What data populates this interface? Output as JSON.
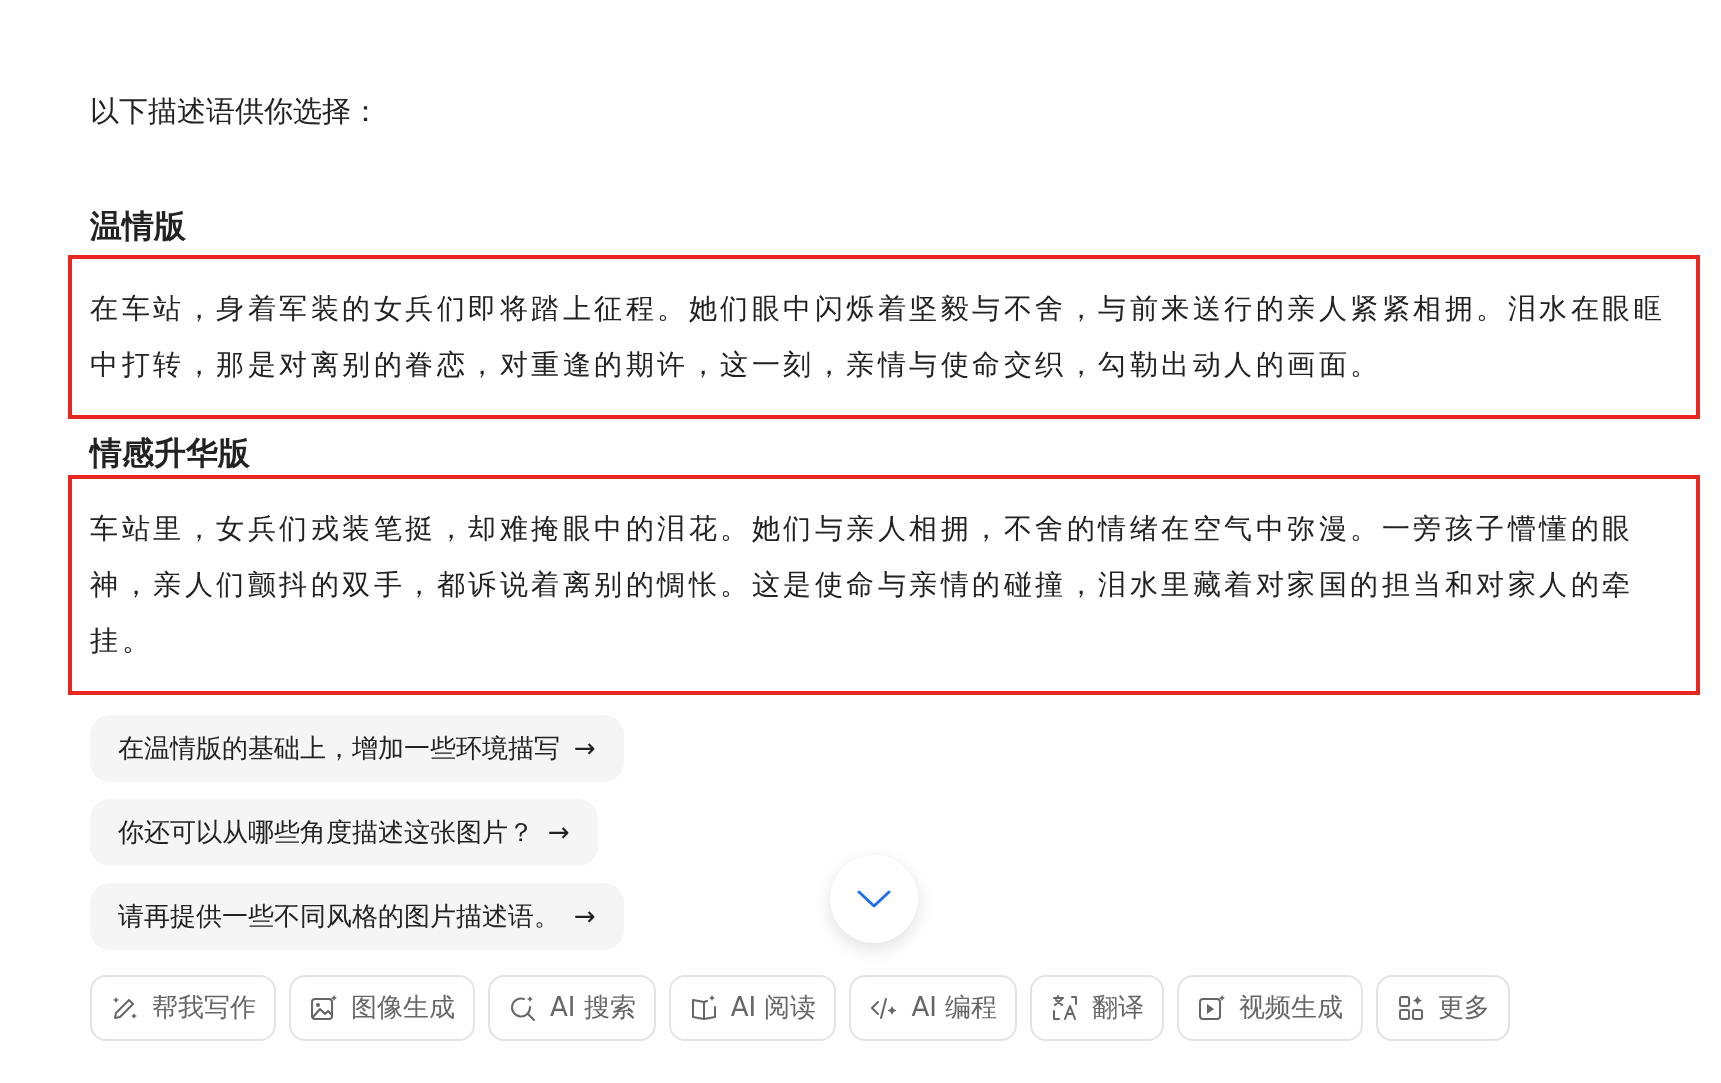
{
  "intro": "以下描述语供你选择：",
  "sections": [
    {
      "title": "温情版",
      "body": "在车站，身着军装的女兵们即将踏上征程。她们眼中闪烁着坚毅与不舍，与前来送行的亲人紧紧相拥。泪水在眼眶中打转，那是对离别的眷恋，对重逢的期许，这一刻，亲情与使命交织，勾勒出动人的画面。",
      "highlighted": true
    },
    {
      "title": "情感升华版",
      "body": "车站里，女兵们戎装笔挺，却难掩眼中的泪花。她们与亲人相拥，不舍的情绪在空气中弥漫。一旁孩子懵懂的眼神，亲人们颤抖的双手，都诉说着离别的惆怅。这是使命与亲情的碰撞，泪水里藏着对家国的担当和对家人的牵挂。",
      "highlighted": true
    }
  ],
  "suggestions": [
    {
      "text": "在温情版的基础上，增加一些环境描写",
      "arrow": "→"
    },
    {
      "text": "你还可以从哪些角度描述这张图片？",
      "arrow": "→"
    },
    {
      "text": "请再提供一些不同风格的图片描述语。",
      "arrow": "→"
    }
  ],
  "toolbar": [
    {
      "label": "帮我写作",
      "kind": "pen"
    },
    {
      "label": "图像生成",
      "kind": "image"
    },
    {
      "label": "AI 搜索",
      "kind": "search"
    },
    {
      "label": "AI 阅读",
      "kind": "book"
    },
    {
      "label": "AI 编程",
      "kind": "code"
    },
    {
      "label": "翻译",
      "kind": "translate"
    },
    {
      "label": "视频生成",
      "kind": "video"
    },
    {
      "label": "更多",
      "kind": "apps"
    }
  ]
}
